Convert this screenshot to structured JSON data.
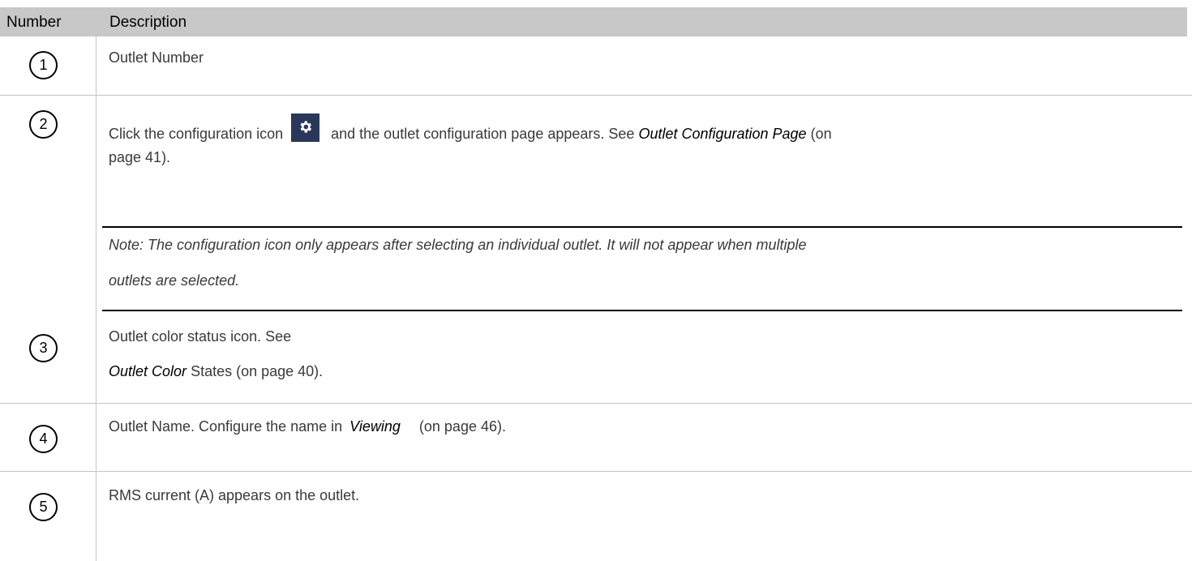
{
  "header": {
    "number_label": "Number",
    "description_label": "Description"
  },
  "rows": [
    {
      "number": "1",
      "text": "Outlet Number"
    },
    {
      "number": "2",
      "line1_prefix": "Click the configuration icon",
      "icon": "gear-icon",
      "line1_suffix": "and the outlet configuration page appears. See",
      "link": "Outlet Configuration Page",
      "line1_end": "(on",
      "line2": "page 41).",
      "note_line1": "Note: The configuration icon only appears after selecting an individual outlet. It will not appear when multiple",
      "note_line2": "outlets are selected."
    },
    {
      "number": "3",
      "line1": "Outlet color status icon. See",
      "link": "Outlet Color",
      "line2_suffix": "States (on page 40)."
    },
    {
      "number": "4",
      "prefix": "Outlet Name. Configure the name in",
      "link": "Viewing",
      "suffix": "(on page 46)."
    },
    {
      "number": "5",
      "text": "RMS current (A) appears on the outlet."
    }
  ],
  "colors": {
    "header_bg": "#c8c8c8",
    "icon_bg": "#29375a",
    "border": "#c4c4c4"
  }
}
